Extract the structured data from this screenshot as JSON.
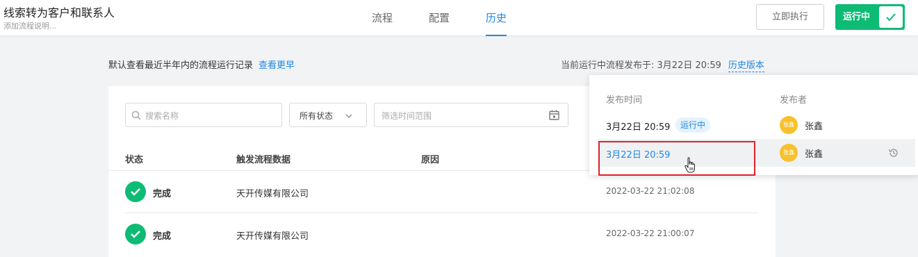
{
  "header": {
    "title": "线索转为客户和联系人",
    "subtitle": "添加流程说明...",
    "tabs": [
      {
        "label": "流程",
        "active": false
      },
      {
        "label": "配置",
        "active": false
      },
      {
        "label": "历史",
        "active": true
      }
    ],
    "run_now_label": "立即执行",
    "toggle_label": "运行中",
    "toggle_on": true
  },
  "info": {
    "left_text": "默认查看最近半年内的流程运行记录",
    "left_link": "查看更早",
    "right_text": "当前运行中流程发布于: 3月22日 20:59",
    "right_link": "历史版本"
  },
  "filters": {
    "search_placeholder": "搜索名称",
    "status_value": "所有状态",
    "date_placeholder": "筛选时间范围"
  },
  "table": {
    "columns": [
      "状态",
      "触发流程数据",
      "原因"
    ],
    "rows": [
      {
        "status": "完成",
        "data": "天开传媒有限公司",
        "time": "2022-03-22 21:02:08"
      },
      {
        "status": "完成",
        "data": "天开传媒有限公司",
        "time": "2022-03-22 21:00:07"
      }
    ]
  },
  "popover": {
    "col_time": "发布时间",
    "col_publisher": "发布者",
    "rows": [
      {
        "time": "3月22日 20:59",
        "badge": "运行中",
        "avatar": "张鑫",
        "name": "张鑫"
      },
      {
        "time": "3月22日 20:59",
        "badge": "",
        "avatar": "张鑫",
        "name": "张鑫"
      }
    ]
  },
  "colors": {
    "accent": "#1e88e5",
    "success": "#0dbb75",
    "highlight_box": "#e0202a",
    "avatar": "#f7c12d"
  },
  "icons": [
    "search-icon",
    "chevron-down-icon",
    "calendar-icon",
    "check-icon",
    "history-icon",
    "hand-cursor-icon"
  ]
}
